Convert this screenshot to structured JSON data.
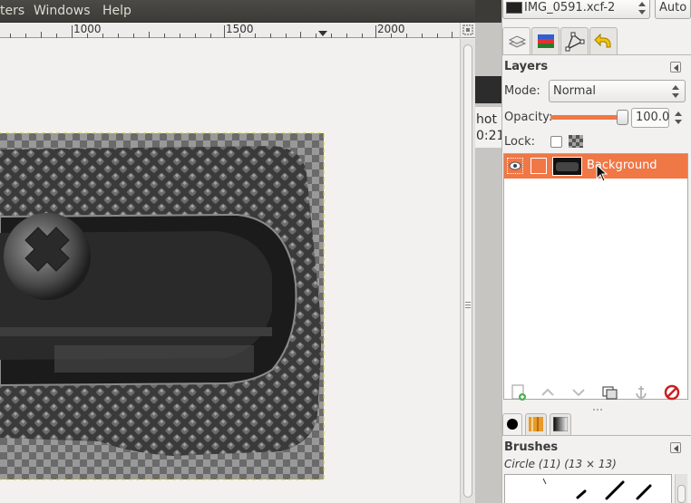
{
  "menubar": {
    "items": [
      "ters",
      "Windows",
      "Help"
    ]
  },
  "ruler": {
    "ticks": [
      "1000",
      "1500",
      "2000"
    ]
  },
  "behind_window": {
    "text1": "hot",
    "text2": "0:21"
  },
  "dock": {
    "image_selector": "IMG_0591.xcf-2",
    "auto_button": "Auto",
    "tabs": [
      "layers-tab",
      "channels-tab",
      "paths-tab",
      "undo-history-tab"
    ]
  },
  "layers": {
    "title": "Layers",
    "mode_label": "Mode:",
    "mode_value": "Normal",
    "opacity_label": "Opacity:",
    "opacity_value": "100.0",
    "opacity_level": 1.0,
    "lock_label": "Lock:",
    "rows": [
      {
        "name": "Background",
        "visible": true,
        "selected": true
      }
    ],
    "selected_color": "#f07746"
  },
  "brushes": {
    "title": "Brushes",
    "current": "Circle (11) (13 × 13)"
  },
  "colors": {
    "accent": "#f07746",
    "menubar": "#3c3b37"
  }
}
